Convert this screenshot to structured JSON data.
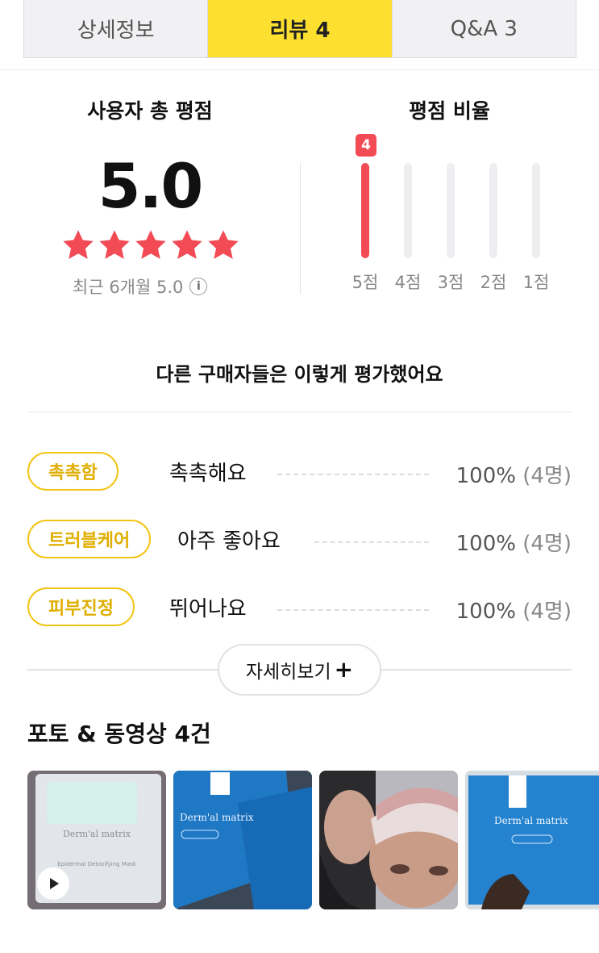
{
  "tabs": [
    {
      "label": "상세정보"
    },
    {
      "label": "리뷰  4"
    },
    {
      "label": "Q&A  3"
    }
  ],
  "summary": {
    "total_title": "사용자 총 평점",
    "score": "5.0",
    "stars_filled": 5,
    "stars_total": 5,
    "recent_text": "최근 6개월 5.0",
    "ratio_title": "평점 비율",
    "bars": [
      {
        "label": "5점",
        "count": 4,
        "badge": "4"
      },
      {
        "label": "4점",
        "count": 0
      },
      {
        "label": "3점",
        "count": 0
      },
      {
        "label": "2점",
        "count": 0
      },
      {
        "label": "1점",
        "count": 0
      }
    ]
  },
  "keywords": {
    "title": "다른 구매자들은 이렇게 평가했어요",
    "items": [
      {
        "tag": "촉촉함",
        "text": "촉촉해요",
        "pct": "100%",
        "count": "(4명)"
      },
      {
        "tag": "트러블케어",
        "text": "아주 좋아요",
        "pct": "100%",
        "count": "(4명)"
      },
      {
        "tag": "피부진정",
        "text": "뛰어나요",
        "pct": "100%",
        "count": "(4명)"
      }
    ],
    "more_label": "자세히보기"
  },
  "photos": {
    "title": "포토 & 동영상 4건",
    "items": [
      {
        "kind": "video",
        "brand": "Derm'al matrix",
        "caption": "Epidermal Detoxifying Mask",
        "icon": "play-icon"
      },
      {
        "kind": "photo",
        "brand": "Derm'al matrix"
      },
      {
        "kind": "photo"
      },
      {
        "kind": "photo",
        "brand": "Derm'al matrix"
      }
    ]
  },
  "colors": {
    "accent_yellow": "#fde02f",
    "star_red": "#f24b55",
    "pill_border": "#f2c414"
  }
}
